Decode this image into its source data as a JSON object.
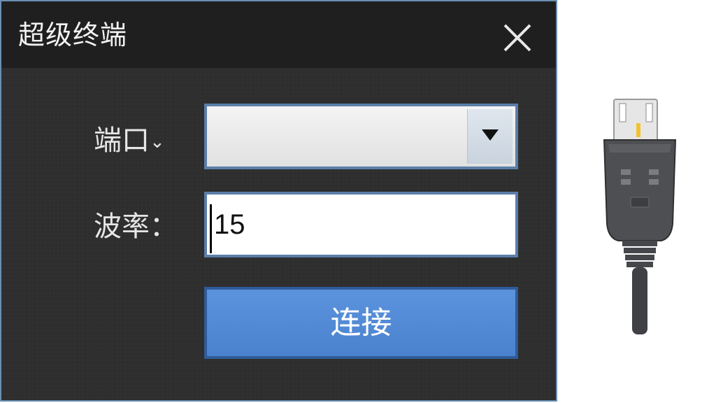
{
  "window": {
    "title": "超级终端"
  },
  "form": {
    "port": {
      "label": "端口",
      "chevron": "⌄",
      "selected_value": ""
    },
    "baud": {
      "label": "波率：",
      "value": "15"
    },
    "connect_label": "连接"
  },
  "icons": {
    "close": "close-icon",
    "dropdown": "triangle-down-icon",
    "usb_plug": "usb-plug-icon"
  },
  "colors": {
    "window_bg": "#2e2e2e",
    "titlebar_bg": "#1f1f1f",
    "border": "#5a7ea8",
    "button": "#4f89d6"
  }
}
